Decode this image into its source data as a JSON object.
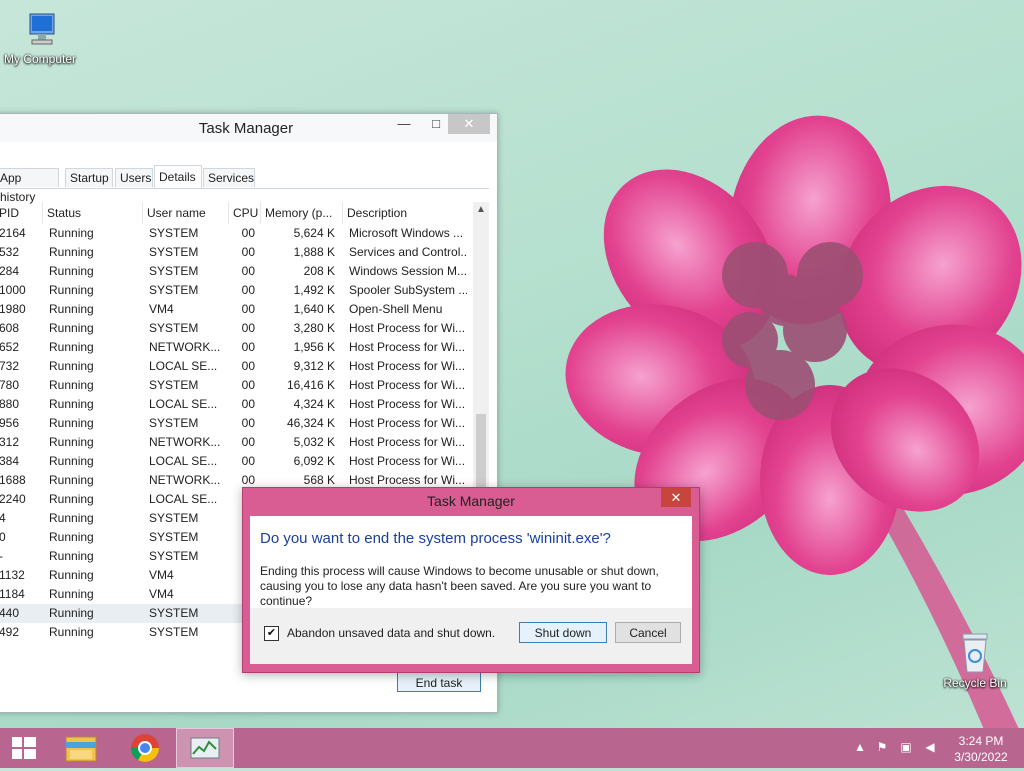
{
  "desktop": {
    "icons": [
      {
        "label": "My Computer"
      },
      {
        "label": "Recycle Bin"
      }
    ]
  },
  "task_manager": {
    "title": "Task Manager",
    "tabs": [
      "App history",
      "Startup",
      "Users",
      "Details",
      "Services"
    ],
    "active_tab": "Details",
    "columns": [
      "PID",
      "Status",
      "User name",
      "CPU",
      "Memory (p...",
      "Description"
    ],
    "rows": [
      {
        "pid": "2164",
        "status": "Running",
        "user": "SYSTEM",
        "cpu": "00",
        "mem": "5,624 K",
        "desc": "Microsoft Windows ..."
      },
      {
        "pid": "532",
        "status": "Running",
        "user": "SYSTEM",
        "cpu": "00",
        "mem": "1,888 K",
        "desc": "Services and Control..."
      },
      {
        "pid": "284",
        "status": "Running",
        "user": "SYSTEM",
        "cpu": "00",
        "mem": "208 K",
        "desc": "Windows Session M..."
      },
      {
        "pid": "1000",
        "status": "Running",
        "user": "SYSTEM",
        "cpu": "00",
        "mem": "1,492 K",
        "desc": "Spooler SubSystem ..."
      },
      {
        "pid": "1980",
        "status": "Running",
        "user": "VM4",
        "cpu": "00",
        "mem": "1,640 K",
        "desc": "Open-Shell Menu"
      },
      {
        "pid": "608",
        "status": "Running",
        "user": "SYSTEM",
        "cpu": "00",
        "mem": "3,280 K",
        "desc": "Host Process for Wi..."
      },
      {
        "pid": "652",
        "status": "Running",
        "user": "NETWORK...",
        "cpu": "00",
        "mem": "1,956 K",
        "desc": "Host Process for Wi..."
      },
      {
        "pid": "732",
        "status": "Running",
        "user": "LOCAL SE...",
        "cpu": "00",
        "mem": "9,312 K",
        "desc": "Host Process for Wi..."
      },
      {
        "pid": "780",
        "status": "Running",
        "user": "SYSTEM",
        "cpu": "00",
        "mem": "16,416 K",
        "desc": "Host Process for Wi..."
      },
      {
        "pid": "880",
        "status": "Running",
        "user": "LOCAL SE...",
        "cpu": "00",
        "mem": "4,324 K",
        "desc": "Host Process for Wi..."
      },
      {
        "pid": "956",
        "status": "Running",
        "user": "SYSTEM",
        "cpu": "00",
        "mem": "46,324 K",
        "desc": "Host Process for Wi..."
      },
      {
        "pid": "312",
        "status": "Running",
        "user": "NETWORK...",
        "cpu": "00",
        "mem": "5,032 K",
        "desc": "Host Process for Wi..."
      },
      {
        "pid": "384",
        "status": "Running",
        "user": "LOCAL SE...",
        "cpu": "00",
        "mem": "6,092 K",
        "desc": "Host Process for Wi..."
      },
      {
        "pid": "1688",
        "status": "Running",
        "user": "NETWORK...",
        "cpu": "00",
        "mem": "568 K",
        "desc": "Host Process for Wi..."
      },
      {
        "pid": "2240",
        "status": "Running",
        "user": "LOCAL SE...",
        "cpu": "0",
        "mem": "",
        "desc": ""
      },
      {
        "pid": "4",
        "status": "Running",
        "user": "SYSTEM",
        "cpu": "0",
        "mem": "",
        "desc": ""
      },
      {
        "pid": "0",
        "status": "Running",
        "user": "SYSTEM",
        "cpu": "9",
        "mem": "",
        "desc": ""
      },
      {
        "pid": "-",
        "status": "Running",
        "user": "SYSTEM",
        "cpu": "0",
        "mem": "",
        "desc": ""
      },
      {
        "pid": "1132",
        "status": "Running",
        "user": "VM4",
        "cpu": "0",
        "mem": "",
        "desc": ""
      },
      {
        "pid": "1184",
        "status": "Running",
        "user": "VM4",
        "cpu": "0",
        "mem": "",
        "desc": ""
      },
      {
        "pid": "440",
        "status": "Running",
        "user": "SYSTEM",
        "cpu": "0",
        "mem": "",
        "desc": "",
        "selected": true
      },
      {
        "pid": "492",
        "status": "Running",
        "user": "SYSTEM",
        "cpu": "0",
        "mem": "",
        "desc": ""
      }
    ],
    "end_task_label": "End task"
  },
  "dialog": {
    "title": "Task Manager",
    "question": "Do you want to end the system process 'wininit.exe'?",
    "message": "Ending this process will cause Windows to become unusable or shut down, causing you to lose any data hasn't been saved. Are you sure you want to continue?",
    "checkbox_label": "Abandon unsaved data and shut down.",
    "checkbox_checked": true,
    "shutdown_label": "Shut down",
    "cancel_label": "Cancel",
    "close_glyph": "✕"
  },
  "taskbar": {
    "apps": [
      "start-icon",
      "file-explorer-icon",
      "chrome-icon",
      "task-manager-icon"
    ],
    "clock_time": "3:24 PM",
    "clock_date": "3/30/2022"
  },
  "colors": {
    "taskbar": "#b8658f",
    "dialog_frame": "#d95c93",
    "question_text": "#1a3f9d"
  }
}
